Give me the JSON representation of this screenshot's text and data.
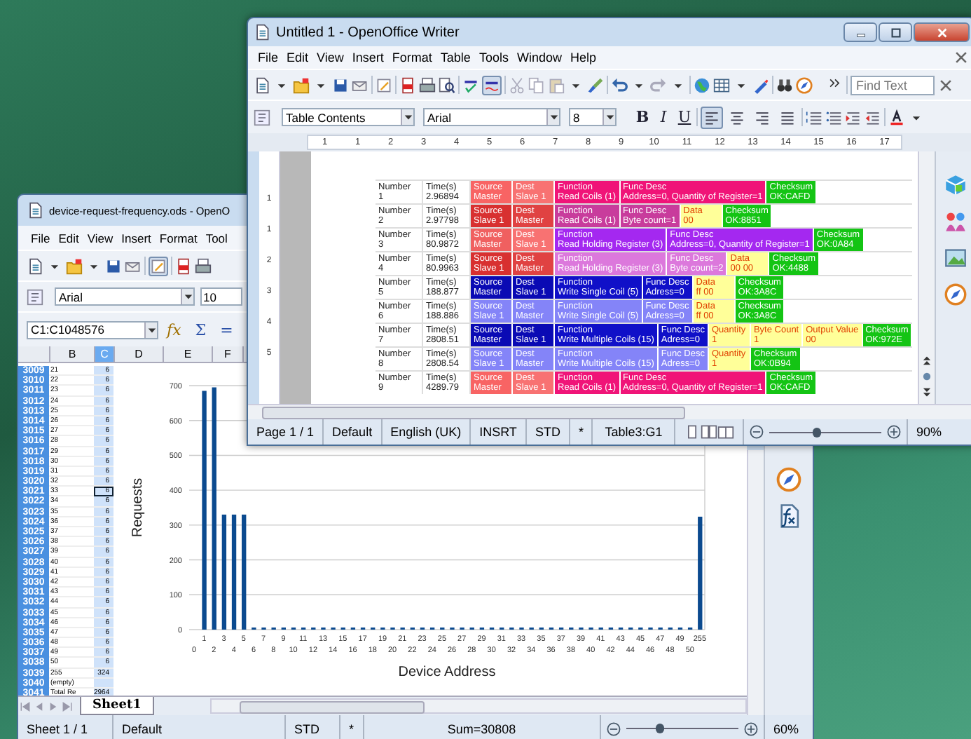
{
  "calc_window": {
    "title": "device-request-frequency.ods - OpenO",
    "menu": [
      "File",
      "Edit",
      "View",
      "Insert",
      "Format",
      "Tool"
    ],
    "edit_mode": true,
    "font": "Arial",
    "font_size": "10",
    "name_box": "C1:C1048576",
    "formula_buttons": [
      "fx",
      "Σ",
      "="
    ],
    "columns": [
      {
        "label": "B",
        "selected": false
      },
      {
        "label": "C",
        "selected": true
      },
      {
        "label": "D",
        "selected": false
      },
      {
        "label": "E",
        "selected": false
      },
      {
        "label": "F",
        "selected": false
      }
    ],
    "rows": [
      {
        "number": "3009",
        "b": "21",
        "c": "6",
        "selected": true,
        "active": false
      },
      {
        "number": "3010",
        "b": "22",
        "c": "6",
        "selected": true,
        "active": false
      },
      {
        "number": "3011",
        "b": "23",
        "c": "6",
        "selected": true,
        "active": false
      },
      {
        "number": "3012",
        "b": "24",
        "c": "6",
        "selected": true,
        "active": false
      },
      {
        "number": "3013",
        "b": "25",
        "c": "6",
        "selected": true,
        "active": false
      },
      {
        "number": "3014",
        "b": "26",
        "c": "6",
        "selected": true,
        "active": false
      },
      {
        "number": "3015",
        "b": "27",
        "c": "6",
        "selected": true,
        "active": false
      },
      {
        "number": "3016",
        "b": "28",
        "c": "6",
        "selected": true,
        "active": false
      },
      {
        "number": "3017",
        "b": "29",
        "c": "6",
        "selected": true,
        "active": false
      },
      {
        "number": "3018",
        "b": "30",
        "c": "6",
        "selected": true,
        "active": false
      },
      {
        "number": "3019",
        "b": "31",
        "c": "6",
        "selected": true,
        "active": false
      },
      {
        "number": "3020",
        "b": "32",
        "c": "6",
        "selected": true,
        "active": false
      },
      {
        "number": "3021",
        "b": "33",
        "c": "6",
        "selected": true,
        "active": true
      },
      {
        "number": "3022",
        "b": "34",
        "c": "6",
        "selected": true,
        "active": false
      },
      {
        "number": "3023",
        "b": "35",
        "c": "6",
        "selected": true,
        "active": false
      },
      {
        "number": "3024",
        "b": "36",
        "c": "6",
        "selected": true,
        "active": false
      },
      {
        "number": "3025",
        "b": "37",
        "c": "6",
        "selected": true,
        "active": false
      },
      {
        "number": "3026",
        "b": "38",
        "c": "6",
        "selected": true,
        "active": false
      },
      {
        "number": "3027",
        "b": "39",
        "c": "6",
        "selected": true,
        "active": false
      },
      {
        "number": "3028",
        "b": "40",
        "c": "6",
        "selected": true,
        "active": false
      },
      {
        "number": "3029",
        "b": "41",
        "c": "6",
        "selected": true,
        "active": false
      },
      {
        "number": "3030",
        "b": "42",
        "c": "6",
        "selected": true,
        "active": false
      },
      {
        "number": "3031",
        "b": "43",
        "c": "6",
        "selected": true,
        "active": false
      },
      {
        "number": "3032",
        "b": "44",
        "c": "6",
        "selected": true,
        "active": false
      },
      {
        "number": "3033",
        "b": "45",
        "c": "6",
        "selected": true,
        "active": false
      },
      {
        "number": "3034",
        "b": "46",
        "c": "6",
        "selected": true,
        "active": false
      },
      {
        "number": "3035",
        "b": "47",
        "c": "6",
        "selected": true,
        "active": false
      },
      {
        "number": "3036",
        "b": "48",
        "c": "6",
        "selected": true,
        "active": false
      },
      {
        "number": "3037",
        "b": "49",
        "c": "6",
        "selected": true,
        "active": false
      },
      {
        "number": "3038",
        "b": "50",
        "c": "6",
        "selected": true,
        "active": false
      },
      {
        "number": "3039",
        "b": "255",
        "c": "324",
        "selected": true,
        "active": false
      },
      {
        "number": "3040",
        "b": "(empty)",
        "selected": true,
        "active": false
      },
      {
        "number": "3041",
        "b": "Total Re",
        "c": "2964",
        "selected": true,
        "active": false
      }
    ],
    "chart": {
      "chart_data": {
        "type": "bar",
        "xlabel": "Device Address",
        "ylabel": "Requests",
        "categories": [
          "0",
          "1",
          "2",
          "3",
          "4",
          "5",
          "6",
          "7",
          "8",
          "9",
          "10",
          "11",
          "12",
          "13",
          "14",
          "15",
          "16",
          "17",
          "18",
          "19",
          "20",
          "21",
          "22",
          "23",
          "24",
          "25",
          "26",
          "27",
          "28",
          "29",
          "30",
          "31",
          "32",
          "33",
          "34",
          "35",
          "36",
          "37",
          "38",
          "39",
          "40",
          "41",
          "42",
          "43",
          "44",
          "45",
          "46",
          "47",
          "48",
          "49",
          "50",
          "255"
        ],
        "values": [
          0,
          685,
          695,
          330,
          330,
          330,
          6,
          6,
          6,
          6,
          6,
          6,
          6,
          6,
          6,
          6,
          6,
          6,
          6,
          6,
          6,
          6,
          6,
          6,
          6,
          6,
          6,
          6,
          6,
          6,
          6,
          6,
          6,
          6,
          6,
          6,
          6,
          6,
          6,
          6,
          6,
          6,
          6,
          6,
          6,
          6,
          6,
          6,
          6,
          6,
          6,
          324
        ],
        "ylim": [
          0,
          700
        ],
        "grid": true,
        "yticks": [
          0,
          100,
          200,
          300,
          400,
          500,
          600,
          700
        ]
      }
    },
    "sheet_tabs": [
      {
        "label": "Sheet1",
        "selected": true
      }
    ],
    "status_bar": {
      "sheet": "Sheet 1 / 1",
      "page_style": "Default",
      "selection_mode": "STD",
      "modified": "*",
      "sum": "Sum=30808",
      "zoom_slider": {
        "level": 0.3
      },
      "zoom": "60%"
    }
  },
  "writer_window": {
    "title": "Untitled 1 - OpenOffice Writer",
    "menu": [
      "File",
      "Edit",
      "View",
      "Insert",
      "Format",
      "Table",
      "Tools",
      "Window",
      "Help"
    ],
    "auto_spellcheck": true,
    "find_placeholder": "Find Text",
    "paragraph_style": "Table Contents",
    "font": "Arial",
    "font_size": "8",
    "format_buttons": [
      "B",
      "I",
      "U"
    ],
    "alignment": [
      {
        "selected": true
      },
      {
        "selected": false
      },
      {
        "selected": false
      },
      {
        "selected": false
      }
    ],
    "ruler": [
      "1",
      "1",
      "2",
      "3",
      "4",
      "5",
      "6",
      "7",
      "8",
      "9",
      "10",
      "11",
      "12",
      "13",
      "14",
      "15",
      "16",
      "17"
    ],
    "vertical_ruler": [
      "1",
      "1",
      "2",
      "3",
      "4",
      "5"
    ],
    "table": [
      {
        "number_label": "Number",
        "number": "1",
        "time_label": "Time(s)",
        "time": "2.96894",
        "segments": [
          {
            "label": "Source",
            "value": "Master",
            "color": "#f86464"
          },
          {
            "label": "Dest",
            "value": "Slave 1",
            "color": "#f87272"
          },
          {
            "label": "Function",
            "value": "Read Coils (1)",
            "color": "#f01478"
          },
          {
            "label": "Func Desc",
            "value": "Address=0, Quantity of Register=1",
            "color": "#f01478"
          },
          {
            "label": "Checksum",
            "value": "OK:CAFD",
            "color": "#14c414"
          }
        ]
      },
      {
        "number_label": "Number",
        "number": "2",
        "time_label": "Time(s)",
        "time": "2.97798",
        "segments": [
          {
            "label": "Source",
            "value": "Slave 1",
            "color": "#d83030"
          },
          {
            "label": "Dest",
            "value": "Master",
            "color": "#e04242"
          },
          {
            "label": "Function",
            "value": "Read Coils (1)",
            "color": "#c83c9c"
          },
          {
            "label": "Func Desc",
            "value": "Byte count=1",
            "color": "#c83c9c"
          },
          {
            "label": "Data",
            "value": "00",
            "color": "#ffff99"
          },
          {
            "label": "Checksum",
            "value": "OK:8851",
            "color": "#14c414"
          }
        ]
      },
      {
        "number_label": "Number",
        "number": "3",
        "time_label": "Time(s)",
        "time": "80.9872",
        "segments": [
          {
            "label": "Source",
            "value": "Master",
            "color": "#f06060"
          },
          {
            "label": "Dest",
            "value": "Slave 1",
            "color": "#f87272"
          },
          {
            "label": "Function",
            "value": "Read Holding Register (3)",
            "color": "#a428f0"
          },
          {
            "label": "Func Desc",
            "value": "Address=0, Quantity of Register=1",
            "color": "#a428f0"
          },
          {
            "label": "Checksum",
            "value": "OK:0A84",
            "color": "#14c414"
          }
        ]
      },
      {
        "number_label": "Number",
        "number": "4",
        "time_label": "Time(s)",
        "time": "80.9963",
        "segments": [
          {
            "label": "Source",
            "value": "Slave 1",
            "color": "#d83030"
          },
          {
            "label": "Dest",
            "value": "Master",
            "color": "#e04242"
          },
          {
            "label": "Function",
            "value": "Read Holding Register (3)",
            "color": "#dc78dc"
          },
          {
            "label": "Func Desc",
            "value": "Byte count=2",
            "color": "#dc78dc"
          },
          {
            "label": "Data",
            "value": "00 00",
            "color": "#ffff99"
          },
          {
            "label": "Checksum",
            "value": "OK:4488",
            "color": "#14c414"
          }
        ]
      },
      {
        "number_label": "Number",
        "number": "5",
        "time_label": "Time(s)",
        "time": "188.877",
        "segments": [
          {
            "label": "Source",
            "value": "Master",
            "color": "#0a0ab4"
          },
          {
            "label": "Dest",
            "value": "Slave 1",
            "color": "#0a0ab4"
          },
          {
            "label": "Function",
            "value": "Write Single Coil (5)",
            "color": "#1010c8"
          },
          {
            "label": "Func Desc",
            "value": "Adress=0",
            "color": "#1010c8"
          },
          {
            "label": "Data",
            "value": "ff 00",
            "color": "#ffff99"
          },
          {
            "label": "Checksum",
            "value": "OK:3A8C",
            "color": "#14c414"
          }
        ]
      },
      {
        "number_label": "Number",
        "number": "6",
        "time_label": "Time(s)",
        "time": "188.886",
        "segments": [
          {
            "label": "Source",
            "value": "Slave 1",
            "color": "#8484f8"
          },
          {
            "label": "Dest",
            "value": "Master",
            "color": "#8484f8"
          },
          {
            "label": "Function",
            "value": "Write Single Coil (5)",
            "color": "#8484f8"
          },
          {
            "label": "Func Desc",
            "value": "Adress=0",
            "color": "#8484f8"
          },
          {
            "label": "Data",
            "value": "ff 00",
            "color": "#ffff99"
          },
          {
            "label": "Checksum",
            "value": "OK:3A8C",
            "color": "#14c414"
          }
        ]
      },
      {
        "number_label": "Number",
        "number": "7",
        "time_label": "Time(s)",
        "time": "2808.51",
        "segments": [
          {
            "label": "Source",
            "value": "Master",
            "color": "#0a0ab4"
          },
          {
            "label": "Dest",
            "value": "Slave 1",
            "color": "#0a0ab4"
          },
          {
            "label": "Function",
            "value": "Write Multiple Coils (15)",
            "color": "#1010c8"
          },
          {
            "label": "Func Desc",
            "value": "Adress=0",
            "color": "#1010c8"
          },
          {
            "label": "Quantity",
            "value": "1",
            "color": "#ffff99"
          },
          {
            "label": "Byte Count",
            "value": "1",
            "color": "#ffff99"
          },
          {
            "label": "Output Value",
            "value": "00",
            "color": "#ffff99"
          },
          {
            "label": "Checksum",
            "value": "OK:972E",
            "color": "#14c414"
          }
        ]
      },
      {
        "number_label": "Number",
        "number": "8",
        "time_label": "Time(s)",
        "time": "2808.54",
        "segments": [
          {
            "label": "Source",
            "value": "Slave 1",
            "color": "#8484f8"
          },
          {
            "label": "Dest",
            "value": "Master",
            "color": "#8484f8"
          },
          {
            "label": "Function",
            "value": "Write Multiple Coils (15)",
            "color": "#8484f8"
          },
          {
            "label": "Func Desc",
            "value": "Adress=0",
            "color": "#8484f8"
          },
          {
            "label": "Quantity",
            "value": "1",
            "color": "#ffff99"
          },
          {
            "label": "Checksum",
            "value": "OK:0B94",
            "color": "#14c414"
          }
        ]
      },
      {
        "number_label": "Number",
        "number": "9",
        "time_label": "Time(s)",
        "time": "4289.79",
        "segments": [
          {
            "label": "Source",
            "value": "Master",
            "color": "#f86464"
          },
          {
            "label": "Dest",
            "value": "Slave 1",
            "color": "#f87272"
          },
          {
            "label": "Function",
            "value": "Read Coils (1)",
            "color": "#f01478"
          },
          {
            "label": "Func Desc",
            "value": "Address=0, Quantity of Register=1",
            "color": "#f01478"
          },
          {
            "label": "Checksum",
            "value": "OK:CAFD",
            "color": "#14c414"
          }
        ]
      }
    ],
    "status_bar": {
      "page": "Page 1 / 1",
      "page_style": "Default",
      "language": "English (UK)",
      "insert_mode": "INSRT",
      "selection_mode": "STD",
      "modified": "*",
      "position": "Table3:G1",
      "zoom_slider": {
        "level": 0.42
      },
      "zoom": "90%"
    }
  }
}
